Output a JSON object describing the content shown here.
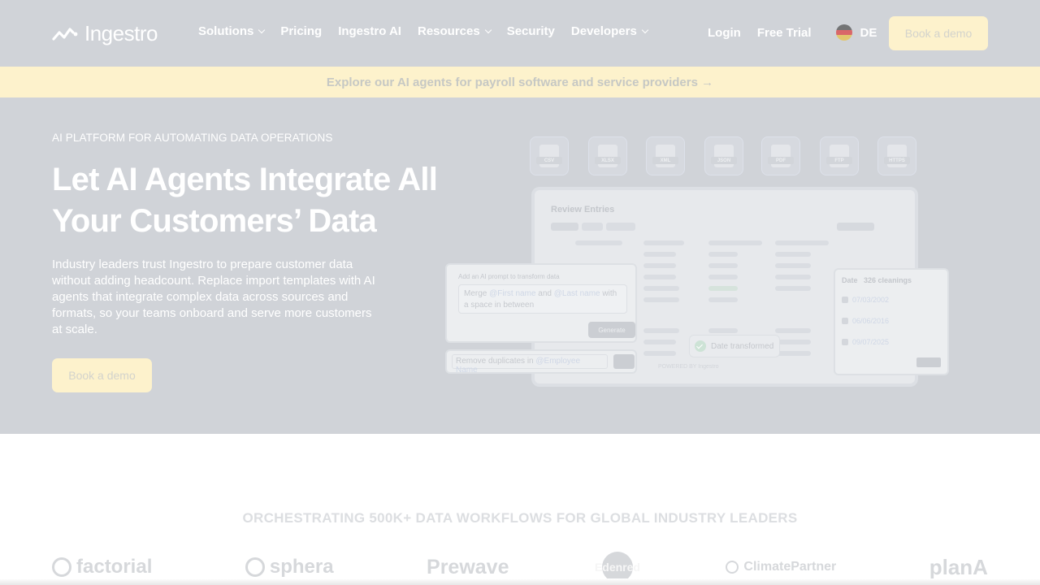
{
  "header": {
    "logo_text": "Ingestro",
    "nav": [
      {
        "label": "Solutions",
        "has_dropdown": true
      },
      {
        "label": "Pricing",
        "has_dropdown": false
      },
      {
        "label": "Ingestro AI",
        "has_dropdown": false
      },
      {
        "label": "Resources",
        "has_dropdown": true
      },
      {
        "label": "Security",
        "has_dropdown": false
      },
      {
        "label": "Developers",
        "has_dropdown": true
      }
    ],
    "login": "Login",
    "free_trial": "Free Trial",
    "language": "DE",
    "cta": "Book a demo"
  },
  "announcement": {
    "text": "Explore our AI agents for payroll software and service providers →"
  },
  "hero": {
    "eyebrow": "AI PLATFORM FOR AUTOMATING DATA OPERATIONS",
    "headline": "Let AI Agents Integrate All Your Customers’ Data",
    "description": "Industry leaders trust Ingestro to prepare customer data without adding headcount. Replace import templates with AI agents that integrate complex data across sources and formats, so your teams onboard and serve more customers at scale.",
    "cta": "Book a demo"
  },
  "illustration": {
    "file_types": [
      "CSV",
      "XLSX",
      "XML",
      "JSON",
      "PDF",
      "FTP",
      "HTTPS"
    ],
    "panel_title": "Review Entries",
    "prompt_label": "Add an AI prompt to transform data",
    "prompt_parts": [
      "Merge ",
      "@First name",
      " and ",
      "@Last name",
      " with a space in between"
    ],
    "generate_label": "Generate",
    "duplicate_prefix": "Remove duplicates in ",
    "duplicate_mention": "@Employee Name",
    "toast": "Date transformed",
    "date_panel": {
      "column": "Date",
      "count_label": "326 cleanings",
      "rows": [
        "07/03/2002",
        "06/06/2016",
        "09/07/2025"
      ]
    },
    "powered_by": "POWERED BY Ingestro"
  },
  "logos_section": {
    "title": "ORCHESTRATING 500K+ DATA WORKFLOWS FOR GLOBAL INDUSTRY LEADERS",
    "brands": [
      "factorial",
      "sphera",
      "Prewave",
      "Edenred",
      "ClimatePartner",
      "planA"
    ]
  },
  "colors": {
    "overlay": "#d0d3d8",
    "cta_bg": "#fdf2cc",
    "text": "#ffffff"
  }
}
